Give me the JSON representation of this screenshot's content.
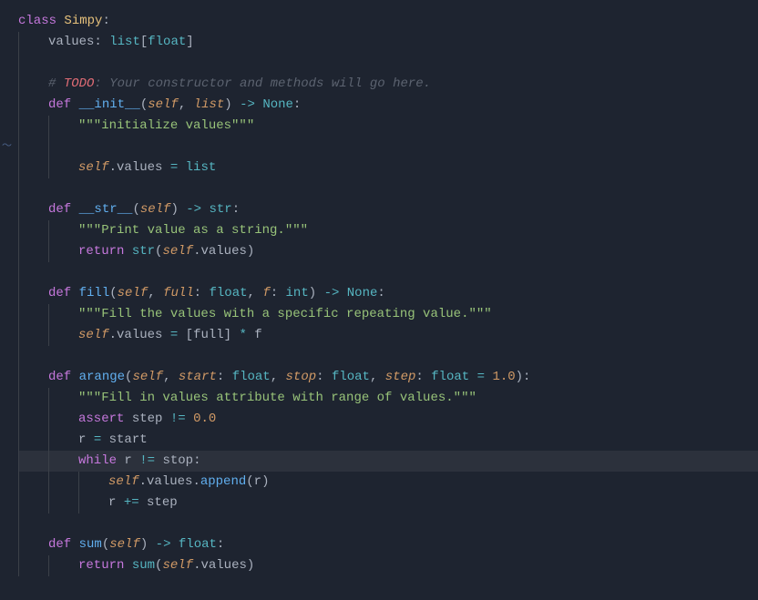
{
  "code": {
    "l0": {
      "kw": "class",
      "name": "Simpy",
      "colon": ":"
    },
    "l1": {
      "var": "values",
      "colon": ": ",
      "typ1": "list",
      "br": "[",
      "typ2": "float",
      "br2": "]"
    },
    "l3": {
      "hash": "# ",
      "todo": "TODO",
      "rest": ": Your constructor and methods will go here."
    },
    "l4": {
      "def": "def",
      "name": "__init__",
      "lp": "(",
      "self": "self",
      "c": ", ",
      "p1": "list",
      "rp": ") ",
      "arrow": "->",
      "sp": " ",
      "ret": "None",
      "colon": ":"
    },
    "l5": {
      "s": "\"\"\"initialize values\"\"\""
    },
    "l7": {
      "self": "self",
      "dot": ".",
      "attr": "values",
      "sp": " ",
      "eq": "=",
      "sp2": " ",
      "val": "list"
    },
    "l9": {
      "def": "def",
      "name": "__str__",
      "lp": "(",
      "self": "self",
      "rp": ") ",
      "arrow": "->",
      "sp": " ",
      "ret": "str",
      "colon": ":"
    },
    "l10": {
      "s": "\"\"\"Print value as a string.\"\"\""
    },
    "l11": {
      "ret": "return",
      "sp": " ",
      "fn": "str",
      "lp": "(",
      "self": "self",
      "dot": ".",
      "attr": "values",
      "rp": ")"
    },
    "l13": {
      "def": "def",
      "name": "fill",
      "lp": "(",
      "self": "self",
      "c1": ", ",
      "p1": "full",
      "col1": ": ",
      "t1": "float",
      "c2": ", ",
      "p2": "f",
      "col2": ": ",
      "t2": "int",
      "rp": ") ",
      "arrow": "->",
      "sp": " ",
      "rett": "None",
      "colon": ":"
    },
    "l14": {
      "s": "\"\"\"Fill the values with a specific repeating value.\"\"\""
    },
    "l15": {
      "self": "self",
      "dot": ".",
      "attr": "values",
      "sp": " ",
      "eq": "=",
      "sp2": " [",
      "var": "full",
      "br": "] ",
      "star": "*",
      "sp3": " ",
      "f": "f"
    },
    "l17": {
      "def": "1.0",
      "name": "arange",
      "lp": "(",
      "self": "self",
      "c1": ", ",
      "p1": "start",
      "col1": ": ",
      "t1": "float",
      "c2": ", ",
      "p2": "stop",
      "col2": ": ",
      "t2": "float",
      "c3": ", ",
      "p3": "step",
      "col3": ": ",
      "t3": "float",
      "sp": " ",
      "eq": "=",
      "sp2": " ",
      "rp": "):",
      "kwdef": "def"
    },
    "l18": {
      "s": "\"\"\"Fill in values attribute with range of values.\"\"\""
    },
    "l19": {
      "kw": "assert",
      "sp": " ",
      "var": "step",
      "sp2": " ",
      "ne": "!=",
      "sp3": " ",
      "num": "0.0"
    },
    "l20": {
      "var": "r",
      "sp": " ",
      "eq": "=",
      "sp2": " ",
      "val": "start"
    },
    "l21": {
      "kw": "while",
      "sp": " ",
      "var": "r",
      "sp2": " ",
      "ne": "!=",
      "sp3": " ",
      "val": "stop",
      "colon": ":"
    },
    "l22": {
      "self": "self",
      "dot": ".",
      "attr": "values",
      "dot2": ".",
      "fn": "append",
      "lp": "(",
      "arg": "r",
      "rp": ")"
    },
    "l23": {
      "var": "r",
      "sp": " ",
      "op": "+=",
      "sp2": " ",
      "val": "step"
    },
    "l25": {
      "def": "def",
      "name": "sum",
      "lp": "(",
      "self": "self",
      "rp": ") ",
      "arrow": "->",
      "sp": " ",
      "ret": "float",
      "colon": ":"
    },
    "l26": {
      "ret": "return",
      "sp": " ",
      "fn": "sum",
      "lp": "(",
      "self": "self",
      "dot": ".",
      "attr": "values",
      "rp": ")"
    }
  }
}
